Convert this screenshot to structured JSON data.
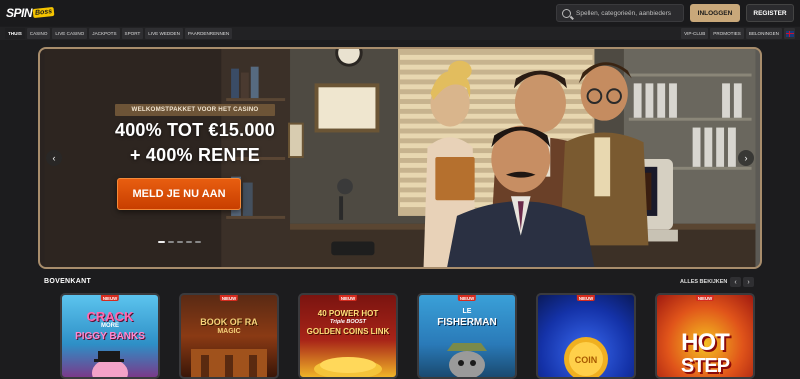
{
  "header": {
    "logo_text_1": "SPIN",
    "logo_text_2": "Boss",
    "search_placeholder": "Spellen, categorieën, aanbieders",
    "login_label": "INLOGGEN",
    "register_label": "REGISTER"
  },
  "nav": {
    "left": [
      "THUIS",
      "CASINO",
      "LIVE CASINO",
      "JACKPOTS",
      "SPORT",
      "LIVE WEDDEN",
      "PAARDENRENNEN"
    ],
    "right": [
      "VIP-CLUB",
      "PROMOTIES",
      "BELONINGEN"
    ],
    "active_index": 0
  },
  "hero": {
    "label": "WELKOMSTPAKKET VOOR HET CASINO",
    "title_line_1": "400% TOT €15.000",
    "title_line_2": "+ 400% RENTE",
    "cta": "MELD JE NU AAN",
    "slides": 5,
    "active_slide": 0
  },
  "section": {
    "title": "BOVENKANT",
    "view_all": "ALLES BEKIJKEN"
  },
  "games": [
    {
      "name": "Crack More Piggy Banks",
      "line1": "CRACK",
      "line2": "MORE",
      "line3": "PIGGY BANKS",
      "badge": "NIEUW",
      "bg": "#3aa7d8"
    },
    {
      "name": "Book of Ra Magic",
      "line1": "BOOK OF RA",
      "line2": "MAGIC",
      "line3": "",
      "badge": "NIEUW",
      "bg": "#5a2a14"
    },
    {
      "name": "40 Power Hot Triple Boost Golden Coins Link",
      "line1": "40 POWER HOT",
      "line2": "Triple BOOST",
      "line3": "GOLDEN COINS LINK",
      "badge": "NIEUW",
      "bg": "#7a1410"
    },
    {
      "name": "Le Fisherman",
      "line1": "LE",
      "line2": "FISHERMAN",
      "line3": "",
      "badge": "NIEUW",
      "bg": "#2f7fb5"
    },
    {
      "name": "Coin",
      "line1": "COIN",
      "line2": "",
      "line3": "",
      "badge": "NIEUW",
      "bg": "#1432a8"
    },
    {
      "name": "Hot Step",
      "line1": "HOT",
      "line2": "STEP",
      "line3": "",
      "badge": "NIEUW",
      "bg": "#e0541a"
    }
  ]
}
